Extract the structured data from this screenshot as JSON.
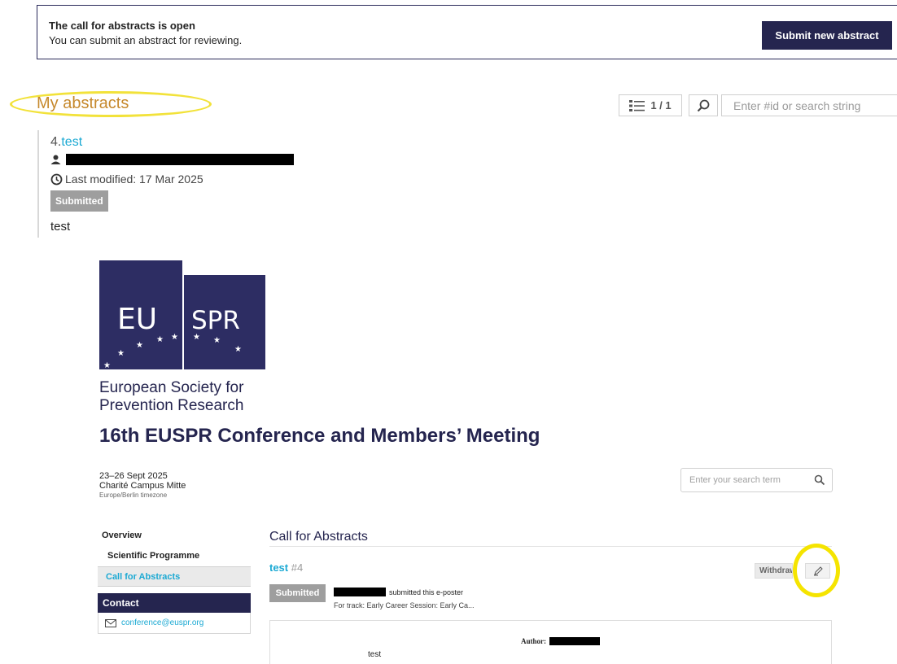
{
  "notice": {
    "title": "The call for abstracts is open",
    "subtitle": "You can submit an abstract for reviewing.",
    "submit_label": "Submit new abstract"
  },
  "my_abstracts": {
    "title": "My abstracts",
    "pager": "1 / 1",
    "search_placeholder": "Enter #id or search string",
    "item": {
      "id_prefix": "4.",
      "title": "test",
      "last_modified": "Last modified: 17 Mar 2025",
      "status": "Submitted",
      "description": "test"
    }
  },
  "conference": {
    "logo_left": "EU",
    "logo_right": "SPR",
    "org_line1": "European Society for",
    "org_line2": "Prevention Research",
    "title": "16th EUSPR Conference and Members’ Meeting",
    "dates": "23–26 Sept 2025",
    "venue": "Charité Campus Mitte",
    "timezone": "Europe/Berlin timezone",
    "search_placeholder": "Enter your search term"
  },
  "sidebar": {
    "items": [
      {
        "label": "Overview"
      },
      {
        "label": "Scientific Programme"
      },
      {
        "label": "Call for Abstracts"
      }
    ],
    "contact_title": "Contact",
    "contact_email": "conference@euspr.org"
  },
  "main": {
    "section_title": "Call for Abstracts",
    "item_title": "test",
    "item_number": "#4",
    "withdraw_label": "Withdraw",
    "status": "Submitted",
    "poster_text": "submitted this e-poster",
    "track_text": "For track: Early Career Session: Early Ca...",
    "author_label": "Author:",
    "content": "test"
  },
  "colors": {
    "navy": "#25254f",
    "link": "#1ba9d3",
    "heading_orange": "#c6892d",
    "highlight_yellow": "#f5e400"
  }
}
